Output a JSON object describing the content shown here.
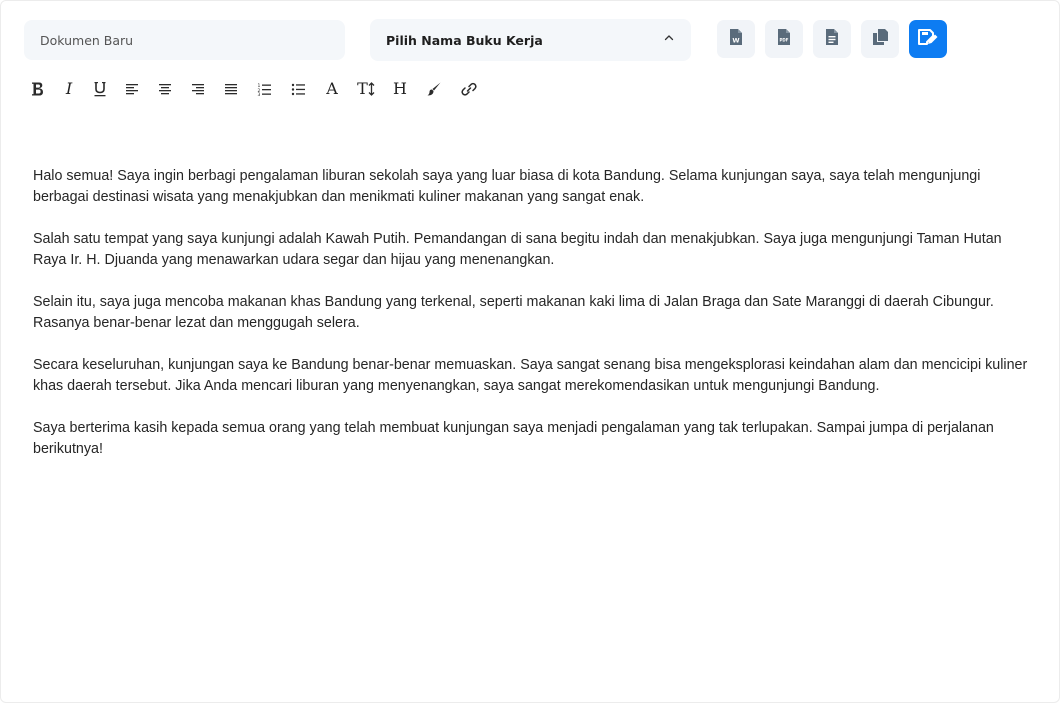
{
  "header": {
    "document_name_placeholder": "Dokumen Baru",
    "workbook_select_label": "Pilih Nama Buku Kerja",
    "workbook_select_icon": "chevron-up-icon",
    "actions": [
      {
        "name": "export-word-button",
        "icon": "file-word-icon",
        "icon_text": "W"
      },
      {
        "name": "export-pdf-button",
        "icon": "file-pdf-icon",
        "icon_text": "PDF"
      },
      {
        "name": "export-text-button",
        "icon": "file-text-icon"
      },
      {
        "name": "copy-button",
        "icon": "copy-icon"
      },
      {
        "name": "save-button",
        "icon": "save-edit-icon"
      }
    ],
    "primary_color": "#0d7cf2",
    "button_bg": "#f1f4f8",
    "icon_color": "#5a6b7b"
  },
  "toolbar": {
    "italic_glyph": "I",
    "font_glyph": "A",
    "size_glyph": "T",
    "heading_glyph": "H"
  },
  "content": {
    "paragraphs": [
      "Halo semua! Saya ingin berbagi pengalaman liburan sekolah saya yang luar biasa di kota Bandung. Selama kunjungan saya, saya telah mengunjungi berbagai destinasi wisata yang menakjubkan dan menikmati kuliner makanan yang sangat enak.",
      "Salah satu tempat yang saya kunjungi adalah Kawah Putih. Pemandangan di sana begitu indah dan menakjubkan. Saya juga mengunjungi Taman Hutan Raya Ir. H. Djuanda yang menawarkan udara segar dan hijau yang menenangkan.",
      "Selain itu, saya juga mencoba makanan khas Bandung yang terkenal, seperti makanan kaki lima di Jalan Braga dan Sate Maranggi di daerah Cibungur. Rasanya benar-benar lezat dan menggugah selera.",
      "Secara keseluruhan, kunjungan saya ke Bandung benar-benar memuaskan. Saya sangat senang bisa mengeksplorasi keindahan alam dan mencicipi kuliner khas daerah tersebut. Jika Anda mencari liburan yang menyenangkan, saya sangat merekomendasikan untuk mengunjungi Bandung.",
      "Saya berterima kasih kepada semua orang yang telah membuat kunjungan saya menjadi pengalaman yang tak terlupakan. Sampai jumpa di perjalanan berikutnya!"
    ]
  }
}
